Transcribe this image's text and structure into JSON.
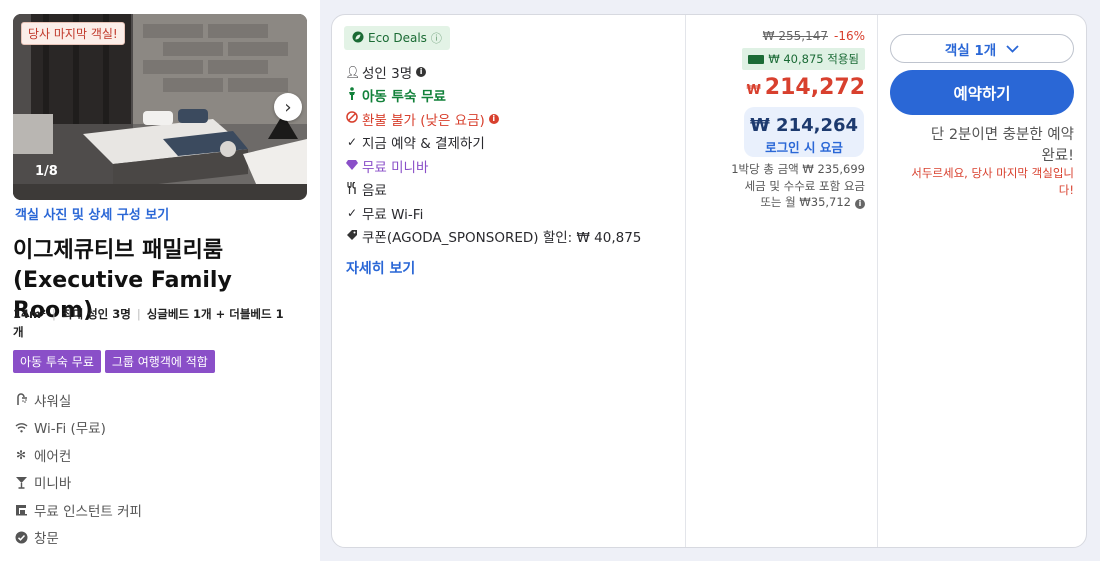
{
  "colors": {
    "accent_blue": "#2a67d6",
    "price_red": "#d8402e",
    "eco_green": "#1a6b34",
    "tag_purple": "#8a4fc8"
  },
  "room": {
    "photo_badge": "당사 마지막 객실!",
    "photo_counter": "1/8",
    "photo_link": "객실 사진 및 상세 구성 보기",
    "title_ko": "이그제큐티브 패밀리룸",
    "title_en": "(Executive Family Room)",
    "size": "14m²",
    "occupancy": "최대 성인 3명",
    "beds_line1": "싱글베드 1개 + 더블베드 1",
    "beds_line2": "개",
    "tags": [
      "아동 투숙 무료",
      "그룹 여행객에 적합"
    ],
    "features": [
      {
        "icon": "shower-icon",
        "label": "샤워실"
      },
      {
        "icon": "wifi-icon",
        "label": "Wi-Fi (무료)"
      },
      {
        "icon": "snowflake-icon",
        "label": "에어컨"
      },
      {
        "icon": "cocktail-icon",
        "label": "미니바"
      },
      {
        "icon": "coffee-maker-icon",
        "label": "무료 인스턴트 커피"
      },
      {
        "icon": "window-icon",
        "label": "창문"
      }
    ]
  },
  "offer": {
    "eco_label": "Eco Deals",
    "benefits": [
      {
        "icon": "person-icon",
        "label": "성인 3명",
        "style": "",
        "info": true
      },
      {
        "icon": "child-icon",
        "label": "아동 투숙 무료",
        "style": "green",
        "info": false
      },
      {
        "icon": "no-refund-icon",
        "label": "환불 불가 (낮은 요금)",
        "style": "red",
        "info": true
      },
      {
        "icon": "check-icon",
        "label": "지금 예약 & 결제하기",
        "style": "",
        "info": false
      },
      {
        "icon": "gem-icon",
        "label": "무료 미니바",
        "style": "purple",
        "info": false
      },
      {
        "icon": "utensils-icon",
        "label": "음료",
        "style": "",
        "info": false
      },
      {
        "icon": "check-icon",
        "label": "무료 Wi-Fi",
        "style": "",
        "info": false
      },
      {
        "icon": "tag-icon",
        "label": "쿠폰(AGODA_SPONSORED) 할인: ₩ 40,875",
        "style": "",
        "info": false
      }
    ],
    "more_link": "자세히 보기"
  },
  "price": {
    "original": "₩ 255,147",
    "discount": "-16%",
    "coupon_applied": "₩ 40,875 적용됨",
    "currency": "₩",
    "amount": "214,272",
    "login_price": "₩ 214,264",
    "login_label": "로그인 시 요금",
    "note_line1": "1박당 총 금액 ₩ 235,699",
    "note_line2": "세금 및 수수료 포함 요금",
    "note_line3": "또는 월 ₩35,712"
  },
  "booking": {
    "room_count": "객실 1개",
    "book_button": "예약하기",
    "urgency_line1": "단 2분이면 충분한 예약",
    "urgency_line2": "완료!",
    "urgency_red1": "서두르세요, 당사 마지막 객실입니",
    "urgency_red2": "다!"
  }
}
